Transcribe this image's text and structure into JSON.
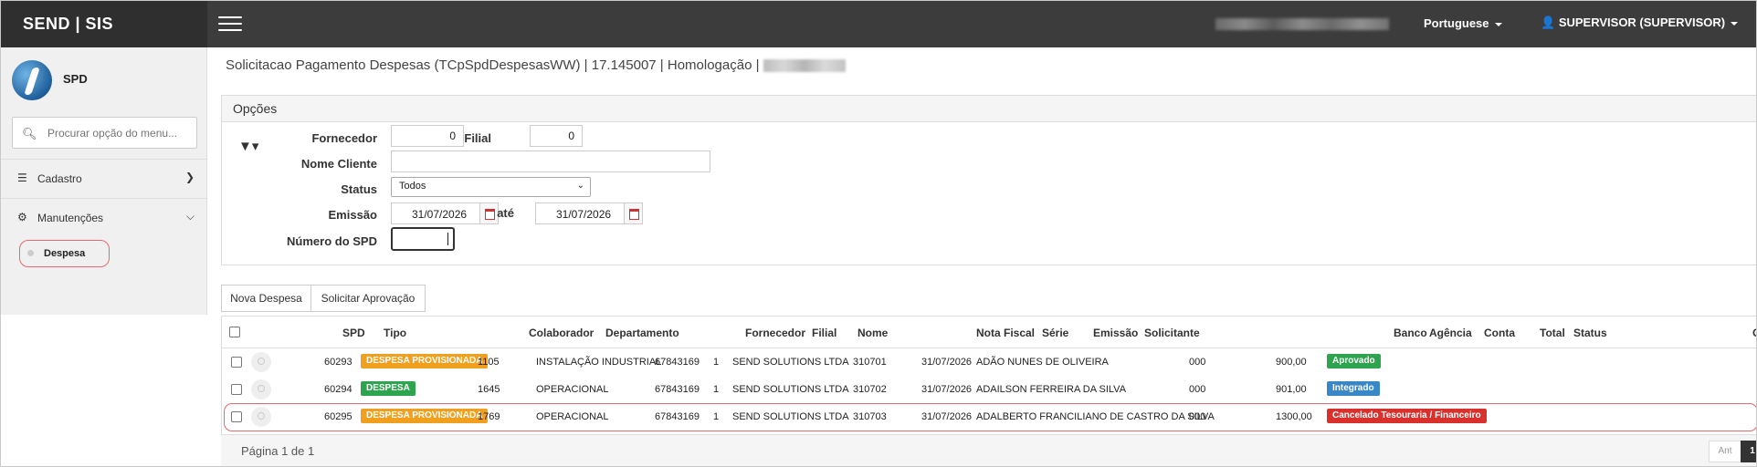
{
  "topbar": {
    "brand": "SEND | SIS",
    "language": "Portuguese",
    "user": "SUPERVISOR (SUPERVISOR)"
  },
  "sidebar": {
    "app_name": "SPD",
    "search_placeholder": "Procurar opção do menu...",
    "items": [
      {
        "label": "Cadastro",
        "icon": "list-icon",
        "chevron": "›"
      },
      {
        "label": "Manutenções",
        "icon": "gears-icon",
        "chevron": "⌄"
      }
    ],
    "sub_item": "Despesa"
  },
  "page": {
    "title": "Solicitacao Pagamento Despesas (TCpSpdDespesasWW) | 17.145007 | Homologação |"
  },
  "options": {
    "heading": "Opções",
    "fornecedor_label": "Fornecedor",
    "fornecedor_value": "0",
    "filial_label": "Filial",
    "filial_value": "0",
    "nome_cliente_label": "Nome Cliente",
    "nome_cliente_value": "",
    "status_label": "Status",
    "status_value": "Todos",
    "emissao_label": "Emissão",
    "emissao_from": "31/07/2026",
    "ate_label": "até",
    "emissao_to": "31/07/2026",
    "numero_spd_label": "Número do SPD"
  },
  "actions": {
    "new_label": "Nova Despesa",
    "approve_label": "Solicitar Aprovação"
  },
  "grid": {
    "headers": {
      "spd": "SPD",
      "tipo": "Tipo",
      "colaborador": "Colaborador",
      "departamento": "Departamento",
      "fornecedor": "Fornecedor",
      "filial": "Filial",
      "nome": "Nome",
      "nota_fiscal": "Nota Fiscal",
      "serie": "Série",
      "emissao": "Emissão",
      "solicitante": "Solicitante",
      "banco": "Banco",
      "agencia": "Agência",
      "conta": "Conta",
      "total": "Total",
      "status": "Status",
      "extra": "C"
    },
    "rows": [
      {
        "spd": "60293",
        "tipo": "DESPESA PROVISIONADA",
        "tipo_color": "#f0a01e",
        "colaborador": "1105",
        "departamento": "INSTALAÇÃO INDUSTRIAL",
        "fornecedor": "67843169",
        "filial": "1",
        "nome": "SEND SOLUTIONS LTDA",
        "nota_fiscal": "310701",
        "emissao": "31/07/2026",
        "solicitante": "ADÃO NUNES DE OLIVEIRA",
        "banco": "000",
        "total": "900,00",
        "status": "Aprovado",
        "status_color": "#2ea44f"
      },
      {
        "spd": "60294",
        "tipo": "DESPESA",
        "tipo_color": "#2ea44f",
        "colaborador": "1645",
        "departamento": "OPERACIONAL",
        "fornecedor": "67843169",
        "filial": "1",
        "nome": "SEND SOLUTIONS LTDA",
        "nota_fiscal": "310702",
        "emissao": "31/07/2026",
        "solicitante": "ADAILSON FERREIRA DA SILVA",
        "banco": "000",
        "total": "901,00",
        "status": "Integrado",
        "status_color": "#3a87c7"
      },
      {
        "spd": "60295",
        "tipo": "DESPESA PROVISIONADA",
        "tipo_color": "#f0a01e",
        "colaborador": "1769",
        "departamento": "OPERACIONAL",
        "fornecedor": "67843169",
        "filial": "1",
        "nome": "SEND SOLUTIONS LTDA",
        "nota_fiscal": "310703",
        "emissao": "31/07/2026",
        "solicitante": "ADALBERTO FRANCILIANO DE CASTRO DA SILVA",
        "banco": "000",
        "total": "1300,00",
        "status": "Cancelado Tesouraria / Financeiro",
        "status_color": "#d9302c"
      }
    ],
    "page_info": "Página 1 de 1",
    "prev_label": "Ant",
    "current_page": "1"
  }
}
